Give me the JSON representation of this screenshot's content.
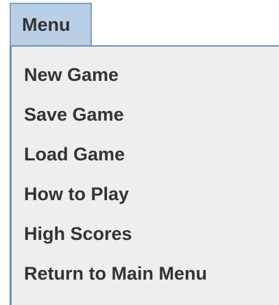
{
  "menu": {
    "title": "Menu",
    "items": [
      {
        "label": "New Game"
      },
      {
        "label": "Save Game"
      },
      {
        "label": "Load Game"
      },
      {
        "label": "How to Play"
      },
      {
        "label": "High Scores"
      },
      {
        "label": "Return to Main Menu"
      }
    ]
  },
  "colors": {
    "menu_title_bg": "#b9cfe6",
    "menu_border": "#6f8fb8",
    "popup_bg": "#eeeeee",
    "text": "#333333"
  }
}
